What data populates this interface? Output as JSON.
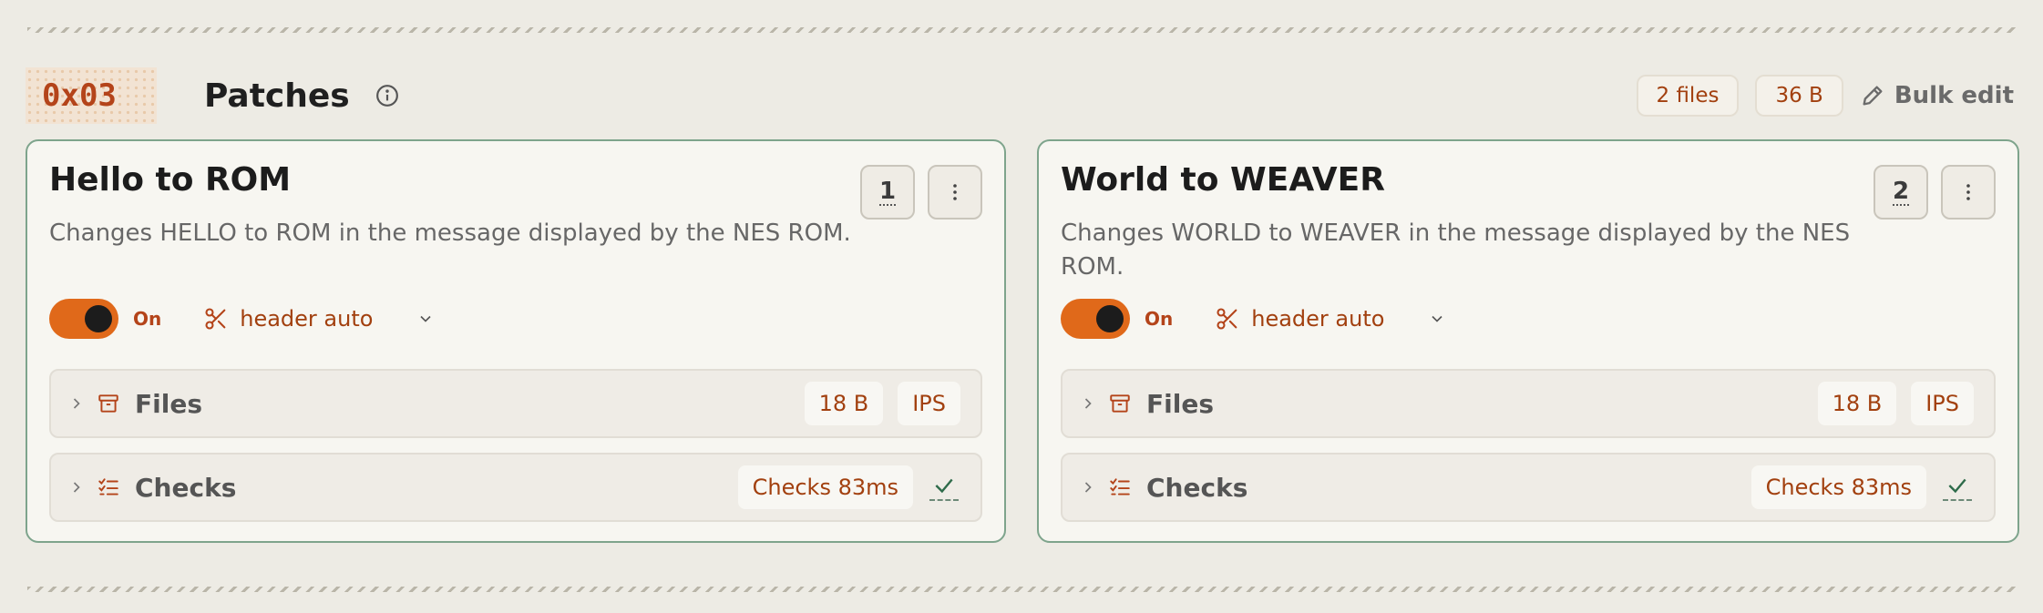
{
  "section": {
    "hex": "0x03",
    "title": "Patches",
    "files_count": "2 files",
    "total_size": "36 B",
    "bulk_edit_label": "Bulk edit"
  },
  "patches": [
    {
      "title": "Hello to ROM",
      "description": "Changes HELLO to ROM in the message displayed by the NES ROM.",
      "order": "1",
      "toggle_label": "On",
      "toggle_on": true,
      "header_mode": "header auto",
      "files": {
        "label": "Files",
        "size": "18 B",
        "format": "IPS"
      },
      "checks": {
        "label": "Checks",
        "timing": "Checks 83ms",
        "status": "passed"
      }
    },
    {
      "title": "World to WEAVER",
      "description": "Changes WORLD to WEAVER in the message displayed by the NES ROM.",
      "order": "2",
      "toggle_label": "On",
      "toggle_on": true,
      "header_mode": "header auto",
      "files": {
        "label": "Files",
        "size": "18 B",
        "format": "IPS"
      },
      "checks": {
        "label": "Checks",
        "timing": "Checks 83ms",
        "status": "passed"
      }
    }
  ],
  "colors": {
    "accent": "#e0691a",
    "accent_text": "#a2400f",
    "card_border": "#7ea48c",
    "success": "#2e6b4a"
  }
}
